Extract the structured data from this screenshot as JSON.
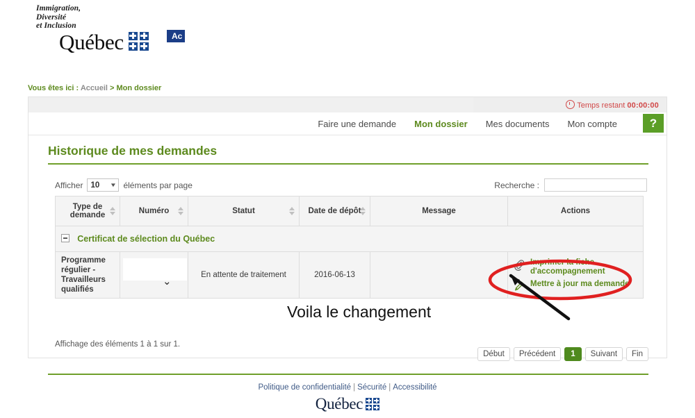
{
  "header": {
    "ministry_lines": [
      "Immigration,",
      "Diversité",
      "et Inclusion"
    ],
    "wordmark": "Québec",
    "access_badge": "Ac"
  },
  "breadcrumb": {
    "label": "Vous êtes ici :",
    "home": "Accueil",
    "separator": ">",
    "current": "Mon dossier"
  },
  "timer": {
    "label": "Temps restant",
    "value": "00:00:00",
    "color": "#d14848"
  },
  "nav": {
    "items": [
      {
        "label": "Faire une demande",
        "active": false
      },
      {
        "label": "Mon dossier",
        "active": true
      },
      {
        "label": "Mes documents",
        "active": false
      },
      {
        "label": "Mon compte",
        "active": false
      }
    ],
    "help_label": "?"
  },
  "page": {
    "title": "Historique de mes demandes",
    "accent_color": "#5d8a1e"
  },
  "controls": {
    "length_prefix": "Afficher",
    "length_value": "10",
    "length_suffix": "éléments par page",
    "search_label": "Recherche :",
    "search_value": "",
    "search_placeholder": ""
  },
  "table": {
    "columns": [
      {
        "label": "Type de demande",
        "sortable": true
      },
      {
        "label": "Numéro",
        "sortable": true
      },
      {
        "label": "Statut",
        "sortable": true
      },
      {
        "label": "Date de dépôt",
        "sortable": true
      },
      {
        "label": "Message",
        "sortable": false
      },
      {
        "label": "Actions",
        "sortable": false
      }
    ],
    "group_label": "Certificat de sélection du Québec",
    "rows": [
      {
        "type": "Programme régulier - Travailleurs qualifiés",
        "numero": "",
        "statut": "En attente de traitement",
        "date_depot": "2016-06-13",
        "message": "",
        "actions": [
          {
            "label": "Imprimer la fiche d'accompagnement",
            "icon": "paperclip-icon"
          },
          {
            "label": "Mettre à jour ma demande",
            "icon": "pencil-icon"
          }
        ]
      }
    ],
    "info": "Affichage des éléments 1 à 1 sur 1."
  },
  "pagination": {
    "first": "Début",
    "previous": "Précédent",
    "current_page": "1",
    "next": "Suivant",
    "last": "Fin"
  },
  "annotation": {
    "text": "Voila le changement",
    "highlight_color": "#e02020"
  },
  "footer": {
    "links": [
      "Politique de confidentialité",
      "Sécurité",
      "Accessibilité"
    ],
    "separator": "|",
    "wordmark": "Québec"
  }
}
